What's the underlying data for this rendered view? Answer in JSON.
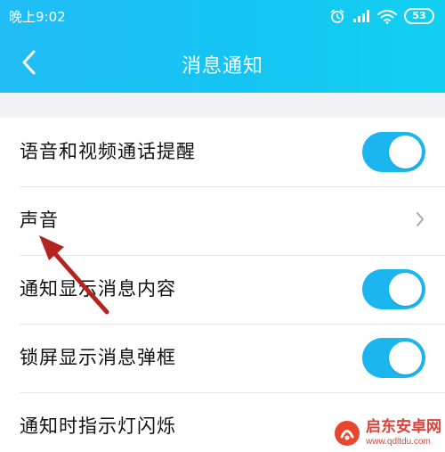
{
  "status_bar": {
    "time": "晚上9:02",
    "battery": "53",
    "icons": [
      "alarm-icon",
      "signal-icon",
      "wifi-icon",
      "battery-icon"
    ]
  },
  "nav": {
    "title": "消息通知",
    "back_icon": "chevron-left-icon"
  },
  "settings": [
    {
      "label": "语音和视频通话提醒",
      "control": "toggle",
      "on": true
    },
    {
      "label": "声音",
      "control": "chevron"
    },
    {
      "label": "通知显示消息内容",
      "control": "toggle",
      "on": true
    },
    {
      "label": "锁屏显示消息弹框",
      "control": "toggle",
      "on": true
    },
    {
      "label": "通知时指示灯闪烁",
      "control": "toggle",
      "on": true
    }
  ],
  "watermark": {
    "name": "启东安卓网",
    "url": "www.qdltdu.com"
  },
  "colors": {
    "header_start": "#22bdf6",
    "header_end": "#12d0ef",
    "toggle_on": "#1bb6f0",
    "annotation_arrow": "#b3231f"
  }
}
